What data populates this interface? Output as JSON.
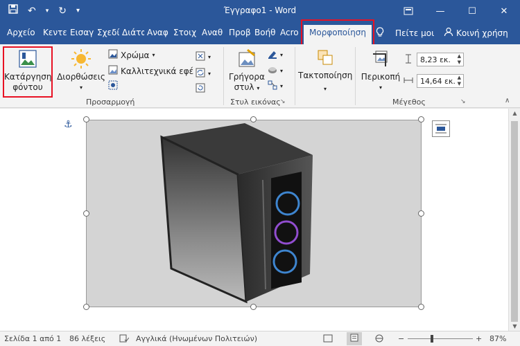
{
  "titlebar": {
    "title": "Έγγραφο1  -  Word",
    "save_icon": "save-icon",
    "undo_icon": "undo-icon",
    "redo_icon": "redo-icon",
    "qat_more": "▾"
  },
  "tabs": {
    "items": [
      "Αρχείο",
      "Κεντε",
      "Εισαγ",
      "Σχεδί",
      "Διάτα",
      "Αναφ",
      "Στοιχ",
      "Αναθ",
      "Προβ",
      "Βοήθ",
      "Acro"
    ],
    "active": "Μορφοποίηση",
    "tell_me": "Πείτε μοι",
    "share": "Κοινή χρήση"
  },
  "ribbon": {
    "remove_bg_line1": "Κατάργηση",
    "remove_bg_line2": "φόντου",
    "corrections": "Διορθώσεις",
    "color": "Χρώμα",
    "artistic": "Καλλιτεχνικά εφέ",
    "group_adjust": "Προσαρμογή",
    "quick_styles_line1": "Γρήγορα",
    "quick_styles_line2": "στυλ",
    "group_styles": "Στυλ εικόνας",
    "arrange": "Τακτοποίηση",
    "crop": "Περικοπή",
    "height": "8,23 εκ.",
    "width": "14,64 εκ.",
    "group_size": "Μέγεθος"
  },
  "status": {
    "page": "Σελίδα 1 από 1",
    "words": "86 λέξεις",
    "language": "Αγγλικά (Ηνωμένων Πολιτειών)",
    "zoom": "87%"
  },
  "colors": {
    "accent": "#2b579a",
    "highlight": "#e81123",
    "ribbon_bg": "#f3f3f3"
  }
}
